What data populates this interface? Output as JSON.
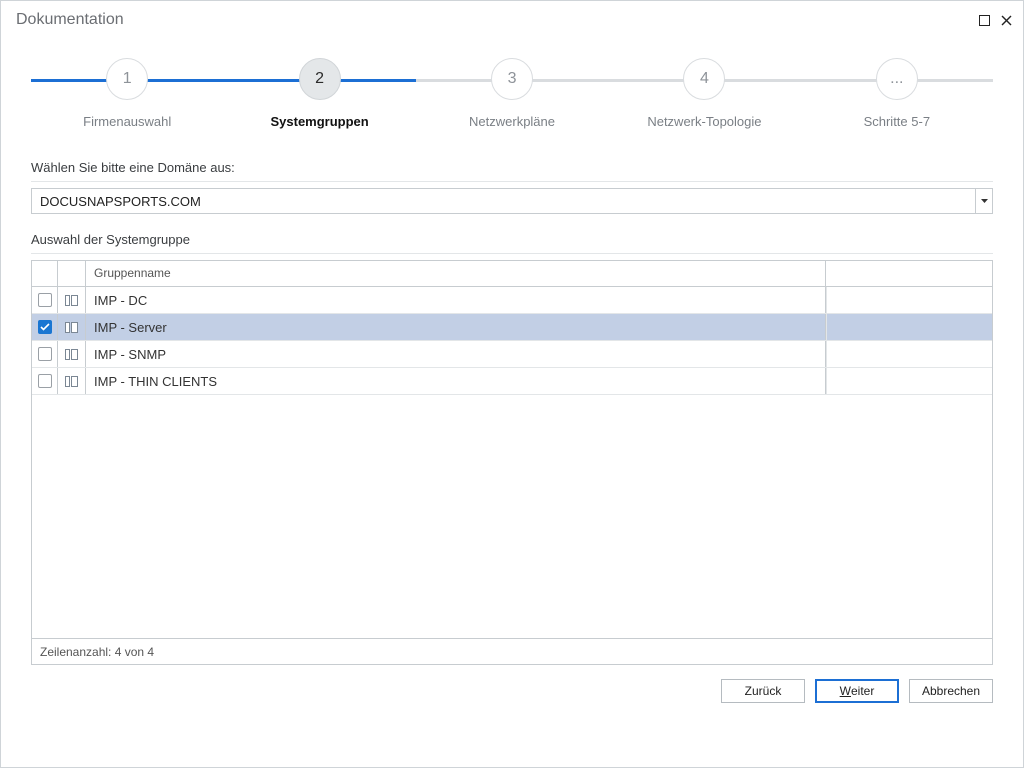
{
  "window": {
    "title": "Dokumentation"
  },
  "wizard": {
    "steps": [
      {
        "num": "1",
        "label": "Firmenauswahl"
      },
      {
        "num": "2",
        "label": "Systemgruppen"
      },
      {
        "num": "3",
        "label": "Netzwerkpläne"
      },
      {
        "num": "4",
        "label": "Netzwerk-Topologie"
      },
      {
        "num": "...",
        "label": "Schritte 5-7"
      }
    ],
    "active_index": 1
  },
  "domain": {
    "label": "Wählen Sie bitte eine Domäne aus:",
    "value": "DOCUSNAPSPORTS.COM"
  },
  "group_section": {
    "label": "Auswahl der Systemgruppe",
    "header": "Gruppenname",
    "rows": [
      {
        "name": "IMP - DC",
        "checked": false,
        "selected": false
      },
      {
        "name": "IMP - Server",
        "checked": true,
        "selected": true
      },
      {
        "name": "IMP - SNMP",
        "checked": false,
        "selected": false
      },
      {
        "name": "IMP - THIN CLIENTS",
        "checked": false,
        "selected": false
      }
    ],
    "footer": "Zeilenanzahl: 4 von 4"
  },
  "buttons": {
    "back": "Zurück",
    "next_prefix": "W",
    "next_rest": "eiter",
    "cancel": "Abbrechen"
  }
}
